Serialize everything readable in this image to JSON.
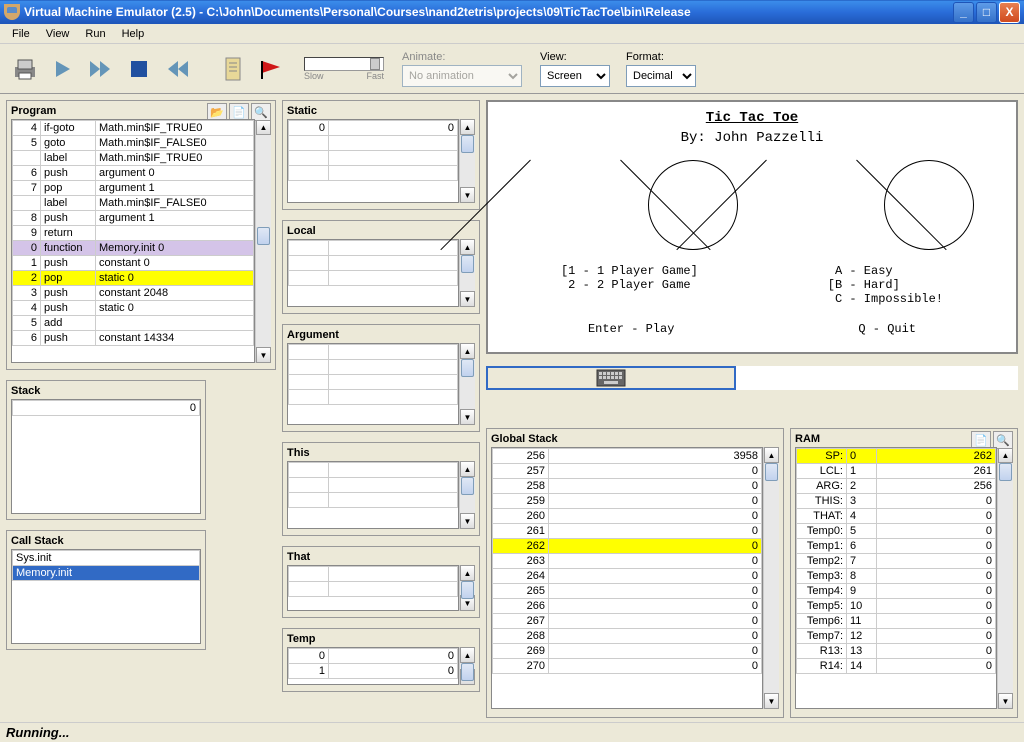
{
  "window": {
    "title": "Virtual Machine Emulator (2.5) - C:\\John\\Documents\\Personal\\Courses\\nand2tetris\\projects\\09\\TicTacToe\\bin\\Release"
  },
  "menu": [
    "File",
    "View",
    "Run",
    "Help"
  ],
  "toolbar": {
    "slider": {
      "slow": "Slow",
      "fast": "Fast"
    },
    "animate_label": "Animate:",
    "animate_value": "No animation",
    "view_label": "View:",
    "view_value": "Screen",
    "format_label": "Format:",
    "format_value": "Decimal"
  },
  "program": {
    "title": "Program",
    "rows": [
      {
        "n": "4",
        "cmd": "if-goto",
        "arg": "Math.min$IF_TRUE0"
      },
      {
        "n": "5",
        "cmd": "goto",
        "arg": "Math.min$IF_FALSE0"
      },
      {
        "n": "",
        "cmd": "label",
        "arg": "Math.min$IF_TRUE0"
      },
      {
        "n": "6",
        "cmd": "push",
        "arg": "argument 0"
      },
      {
        "n": "7",
        "cmd": "pop",
        "arg": "argument 1"
      },
      {
        "n": "",
        "cmd": "label",
        "arg": "Math.min$IF_FALSE0"
      },
      {
        "n": "8",
        "cmd": "push",
        "arg": "argument 1"
      },
      {
        "n": "9",
        "cmd": "return",
        "arg": ""
      },
      {
        "n": "0",
        "cmd": "function",
        "arg": "Memory.init 0",
        "cls": "hl-purple"
      },
      {
        "n": "1",
        "cmd": "push",
        "arg": "constant 0"
      },
      {
        "n": "2",
        "cmd": "pop",
        "arg": "static 0",
        "cls": "hl-yellow"
      },
      {
        "n": "3",
        "cmd": "push",
        "arg": "constant 2048"
      },
      {
        "n": "4",
        "cmd": "push",
        "arg": "static 0"
      },
      {
        "n": "5",
        "cmd": "add",
        "arg": ""
      },
      {
        "n": "6",
        "cmd": "push",
        "arg": "constant 14334"
      }
    ]
  },
  "stack": {
    "title": "Stack",
    "val": "0"
  },
  "callstack": {
    "title": "Call Stack",
    "rows": [
      "Sys.init",
      "Memory.init"
    ]
  },
  "segments": {
    "static": {
      "title": "Static",
      "rows": [
        {
          "a": "0",
          "v": "0"
        }
      ],
      "blank": 3
    },
    "local": {
      "title": "Local",
      "blank": 3
    },
    "argument": {
      "title": "Argument",
      "blank": 4
    },
    "this": {
      "title": "This",
      "blank": 3
    },
    "that": {
      "title": "That",
      "blank": 2
    },
    "temp": {
      "title": "Temp",
      "rows": [
        {
          "a": "0",
          "v": "0"
        },
        {
          "a": "1",
          "v": "0"
        }
      ]
    }
  },
  "screen": {
    "title": "Tic Tac Toe",
    "author": "By: John Pazzelli",
    "opt_left": "[1 - 1 Player Game]\n 2 - 2 Player Game",
    "opt_right": " A - Easy\n[B - Hard]\n C - Impossible!",
    "enter": "Enter - Play",
    "quit": "Q - Quit"
  },
  "globalstack": {
    "title": "Global Stack",
    "rows": [
      {
        "a": "256",
        "v": "3958"
      },
      {
        "a": "257",
        "v": "0"
      },
      {
        "a": "258",
        "v": "0"
      },
      {
        "a": "259",
        "v": "0"
      },
      {
        "a": "260",
        "v": "0"
      },
      {
        "a": "261",
        "v": "0"
      },
      {
        "a": "262",
        "v": "0",
        "cls": "hl-yellow"
      },
      {
        "a": "263",
        "v": "0"
      },
      {
        "a": "264",
        "v": "0"
      },
      {
        "a": "265",
        "v": "0"
      },
      {
        "a": "266",
        "v": "0"
      },
      {
        "a": "267",
        "v": "0"
      },
      {
        "a": "268",
        "v": "0"
      },
      {
        "a": "269",
        "v": "0"
      },
      {
        "a": "270",
        "v": "0"
      }
    ]
  },
  "ram": {
    "title": "RAM",
    "rows": [
      {
        "l": "SP:",
        "a": "0",
        "v": "262",
        "cls": "hl-yellow"
      },
      {
        "l": "LCL:",
        "a": "1",
        "v": "261"
      },
      {
        "l": "ARG:",
        "a": "2",
        "v": "256"
      },
      {
        "l": "THIS:",
        "a": "3",
        "v": "0"
      },
      {
        "l": "THAT:",
        "a": "4",
        "v": "0"
      },
      {
        "l": "Temp0:",
        "a": "5",
        "v": "0"
      },
      {
        "l": "Temp1:",
        "a": "6",
        "v": "0"
      },
      {
        "l": "Temp2:",
        "a": "7",
        "v": "0"
      },
      {
        "l": "Temp3:",
        "a": "8",
        "v": "0"
      },
      {
        "l": "Temp4:",
        "a": "9",
        "v": "0"
      },
      {
        "l": "Temp5:",
        "a": "10",
        "v": "0"
      },
      {
        "l": "Temp6:",
        "a": "11",
        "v": "0"
      },
      {
        "l": "Temp7:",
        "a": "12",
        "v": "0"
      },
      {
        "l": "R13:",
        "a": "13",
        "v": "0"
      },
      {
        "l": "R14:",
        "a": "14",
        "v": "0"
      }
    ]
  },
  "status": "Running..."
}
